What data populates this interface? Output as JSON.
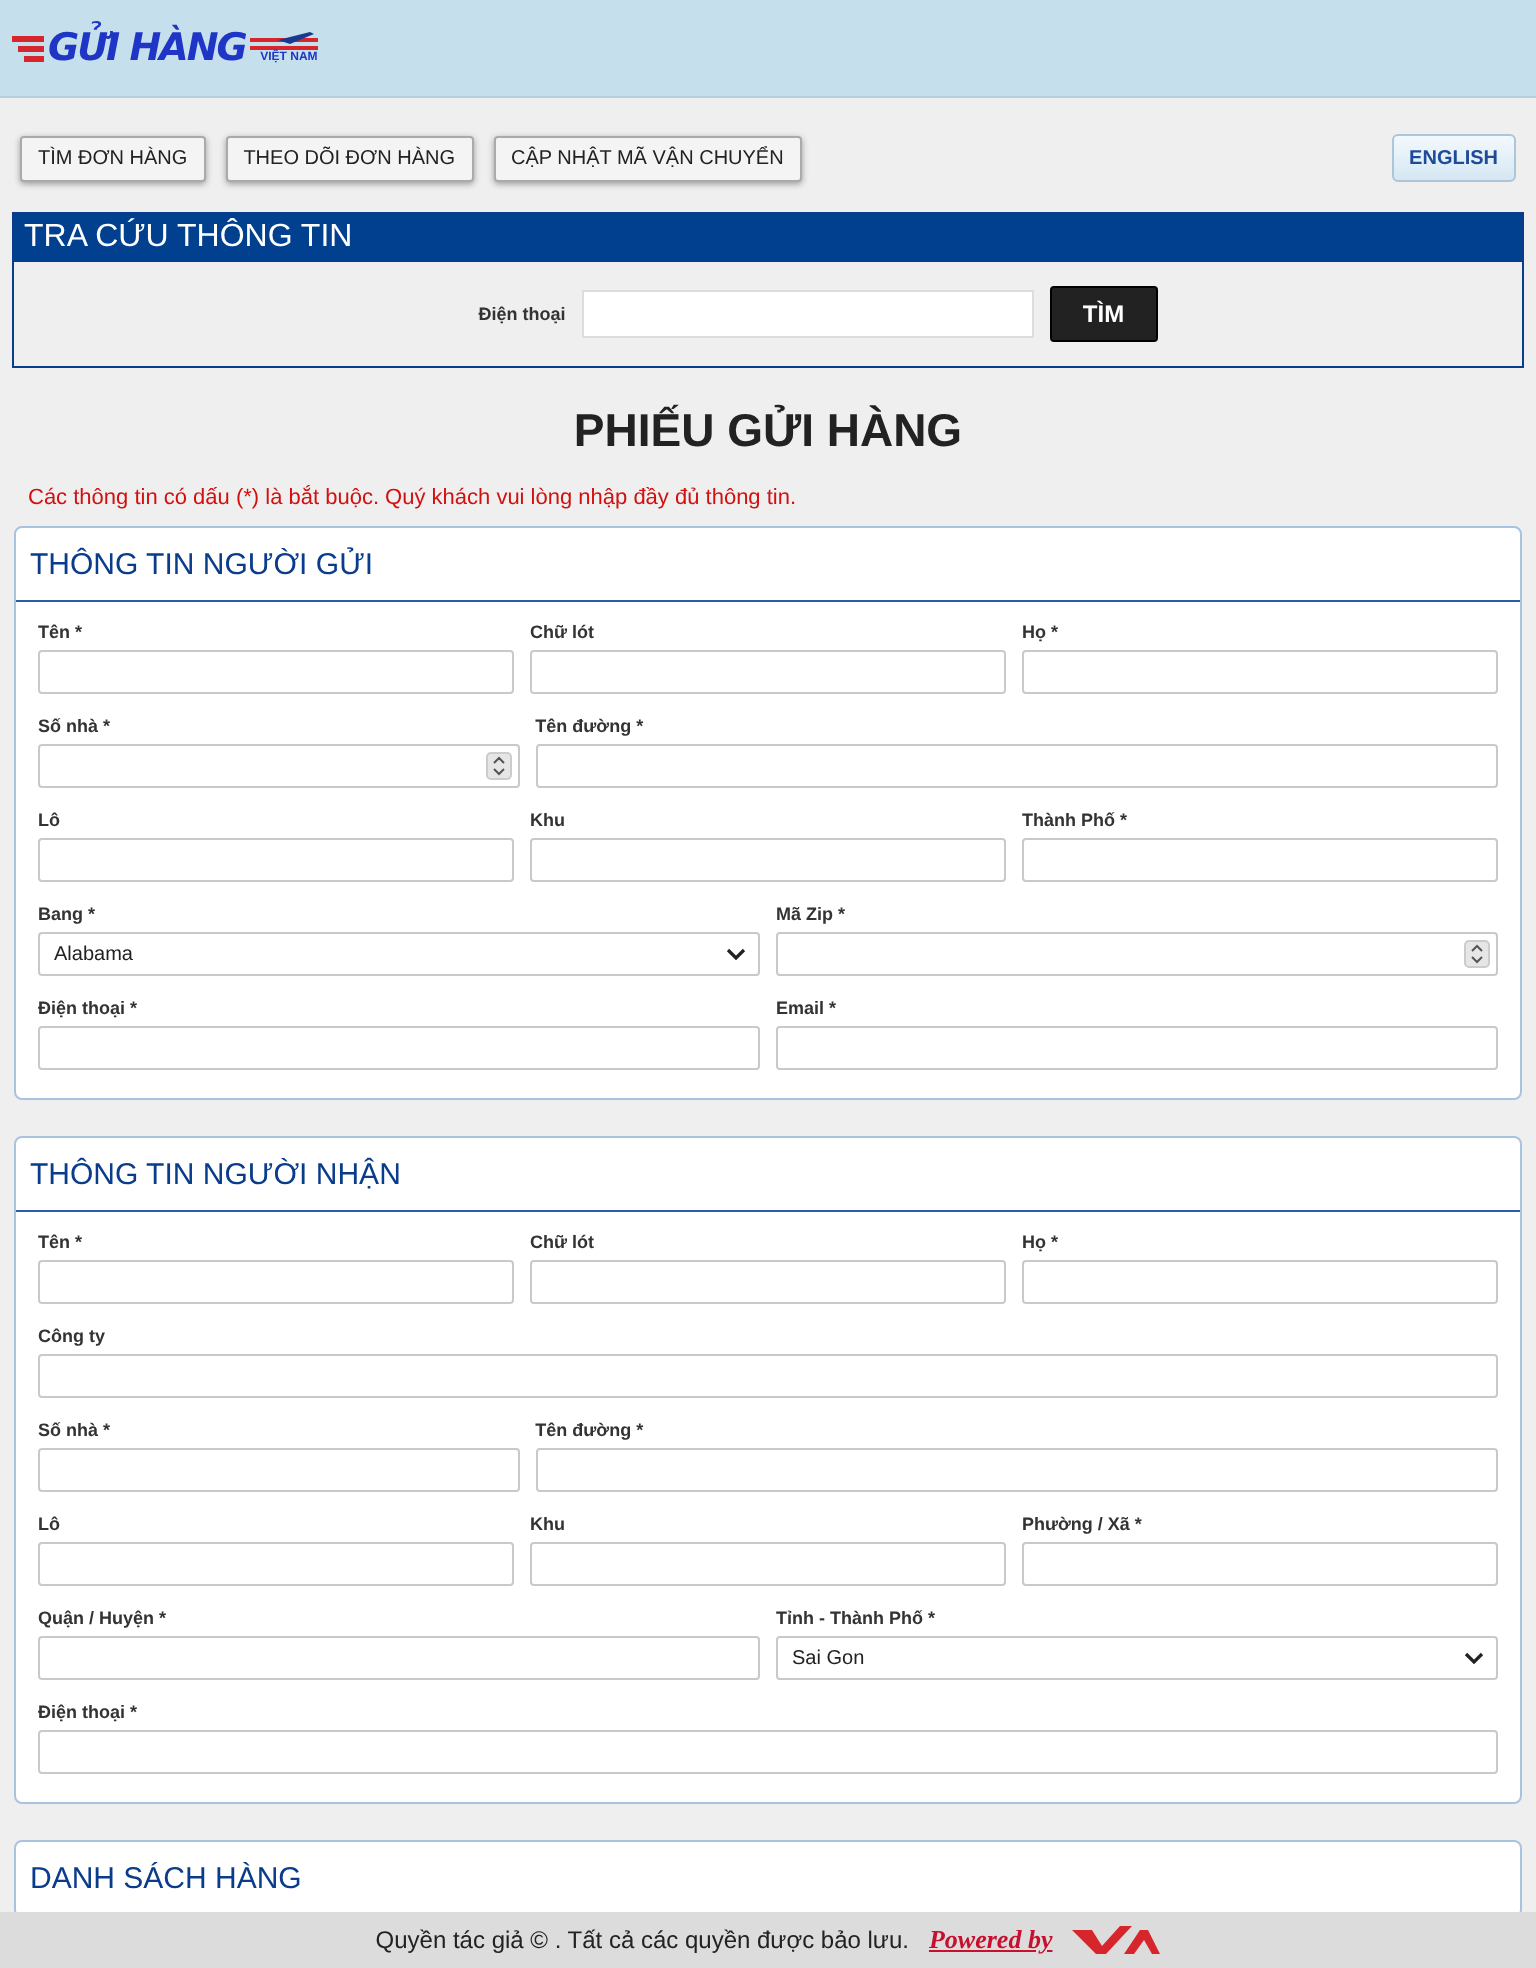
{
  "header": {
    "logo_text": "GỬI HÀNG",
    "logo_subtext": "VIỆT NAM"
  },
  "nav": {
    "buttons": [
      "TÌM ĐƠN HÀNG",
      "THEO DÕI ĐƠN HÀNG",
      "CẬP NHẬT MÃ VẬN CHUYỂN"
    ],
    "language_button": "ENGLISH"
  },
  "lookup": {
    "title": "TRA CỨU THÔNG TIN",
    "label": "Điện thoại",
    "button": "TÌM"
  },
  "page_title": "PHIẾU GỬI HÀNG",
  "notice": "Các thông tin có dấu (*) là bắt buộc. Quý khách vui lòng nhập đầy đủ thông tin.",
  "sections": [
    {
      "title": "THÔNG TIN NGƯỜI GỬI",
      "rows": [
        {
          "kind": "even",
          "fields": [
            {
              "label": "Tên *",
              "kind": "text"
            },
            {
              "label": "Chữ lót",
              "kind": "text"
            },
            {
              "label": "Họ *",
              "kind": "text"
            }
          ]
        },
        {
          "kind": "split",
          "fields": [
            {
              "label": "Số nhà *",
              "kind": "number"
            },
            {
              "label": "Tên đường *",
              "kind": "text"
            }
          ]
        },
        {
          "kind": "even",
          "fields": [
            {
              "label": "Lô",
              "kind": "text"
            },
            {
              "label": "Khu",
              "kind": "text"
            },
            {
              "label": "Thành Phố *",
              "kind": "text"
            }
          ]
        },
        {
          "kind": "even",
          "fields": [
            {
              "label": "Bang *",
              "kind": "select",
              "value": "Alabama"
            },
            {
              "label": "Mã Zip *",
              "kind": "number"
            }
          ]
        },
        {
          "kind": "even",
          "fields": [
            {
              "label": "Điện thoại *",
              "kind": "text"
            },
            {
              "label": "Email *",
              "kind": "text"
            }
          ]
        }
      ]
    },
    {
      "title": "THÔNG TIN NGƯỜI NHẬN",
      "rows": [
        {
          "kind": "even",
          "fields": [
            {
              "label": "Tên *",
              "kind": "text"
            },
            {
              "label": "Chữ lót",
              "kind": "text"
            },
            {
              "label": "Họ *",
              "kind": "text"
            }
          ]
        },
        {
          "kind": "even",
          "fields": [
            {
              "label": "Công ty",
              "kind": "text"
            }
          ]
        },
        {
          "kind": "split",
          "fields": [
            {
              "label": "Số nhà *",
              "kind": "text"
            },
            {
              "label": "Tên đường *",
              "kind": "text"
            }
          ]
        },
        {
          "kind": "even",
          "fields": [
            {
              "label": "Lô",
              "kind": "text"
            },
            {
              "label": "Khu",
              "kind": "text"
            },
            {
              "label": "Phường / Xã *",
              "kind": "text"
            }
          ]
        },
        {
          "kind": "even",
          "fields": [
            {
              "label": "Quận / Huyện *",
              "kind": "text"
            },
            {
              "label": "Tỉnh - Thành Phố *",
              "kind": "select",
              "value": "Sai Gon"
            }
          ]
        },
        {
          "kind": "even",
          "fields": [
            {
              "label": "Điện thoại *",
              "kind": "text"
            }
          ]
        }
      ]
    },
    {
      "title": "DANH SÁCH HÀNG"
    }
  ],
  "footer": {
    "copyright": "Quyền tác giả © . Tất cả các quyền được bảo lưu.",
    "powered_by": "Powered by"
  }
}
